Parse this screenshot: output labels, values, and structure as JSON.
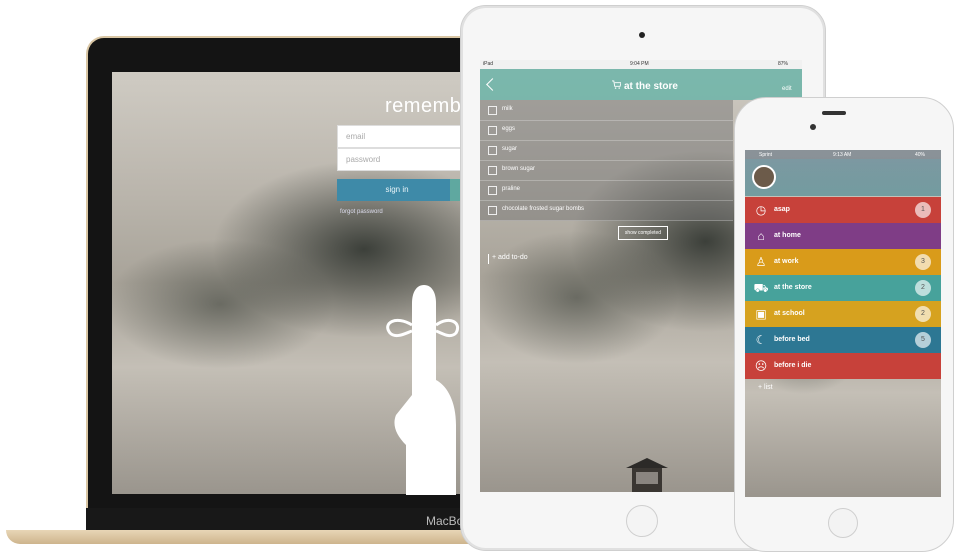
{
  "macbook": {
    "app_title": "remembe",
    "email_placeholder": "email",
    "password_placeholder": "password",
    "signin_label": "sign in",
    "forgot_label": "forgot password",
    "brand": "MacBo"
  },
  "ipad": {
    "status": {
      "carrier": "iPad",
      "time": "9:04 PM",
      "battery": "87%"
    },
    "title": "at the store",
    "edit_label": "edit",
    "todos": [
      "milk",
      "eggs",
      "sugar",
      "brown sugar",
      "praline",
      "chocolate frosted sugar bombs"
    ],
    "show_completed_label": "show completed",
    "add_todo_label": "+ add to-do"
  },
  "iphone": {
    "status": {
      "carrier": "Sprint",
      "time": "9:13 AM",
      "battery": "40%"
    },
    "lists": [
      {
        "label": "asap",
        "count": "1",
        "color": "#c7413a",
        "icon": "stopwatch-icon"
      },
      {
        "label": "at home",
        "count": "",
        "color": "#7f3d86",
        "icon": "house-icon"
      },
      {
        "label": "at work",
        "count": "3",
        "color": "#d99b1a",
        "icon": "office-chair-icon"
      },
      {
        "label": "at the store",
        "count": "2",
        "color": "#47a29b",
        "icon": "cart-icon"
      },
      {
        "label": "at school",
        "count": "2",
        "color": "#d6a21f",
        "icon": "school-bus-icon"
      },
      {
        "label": "before bed",
        "count": "5",
        "color": "#2d7793",
        "icon": "bed-icon"
      },
      {
        "label": "before i die",
        "count": "",
        "color": "#c7413a",
        "icon": "skull-icon"
      }
    ],
    "add_list_label": "+ list"
  }
}
